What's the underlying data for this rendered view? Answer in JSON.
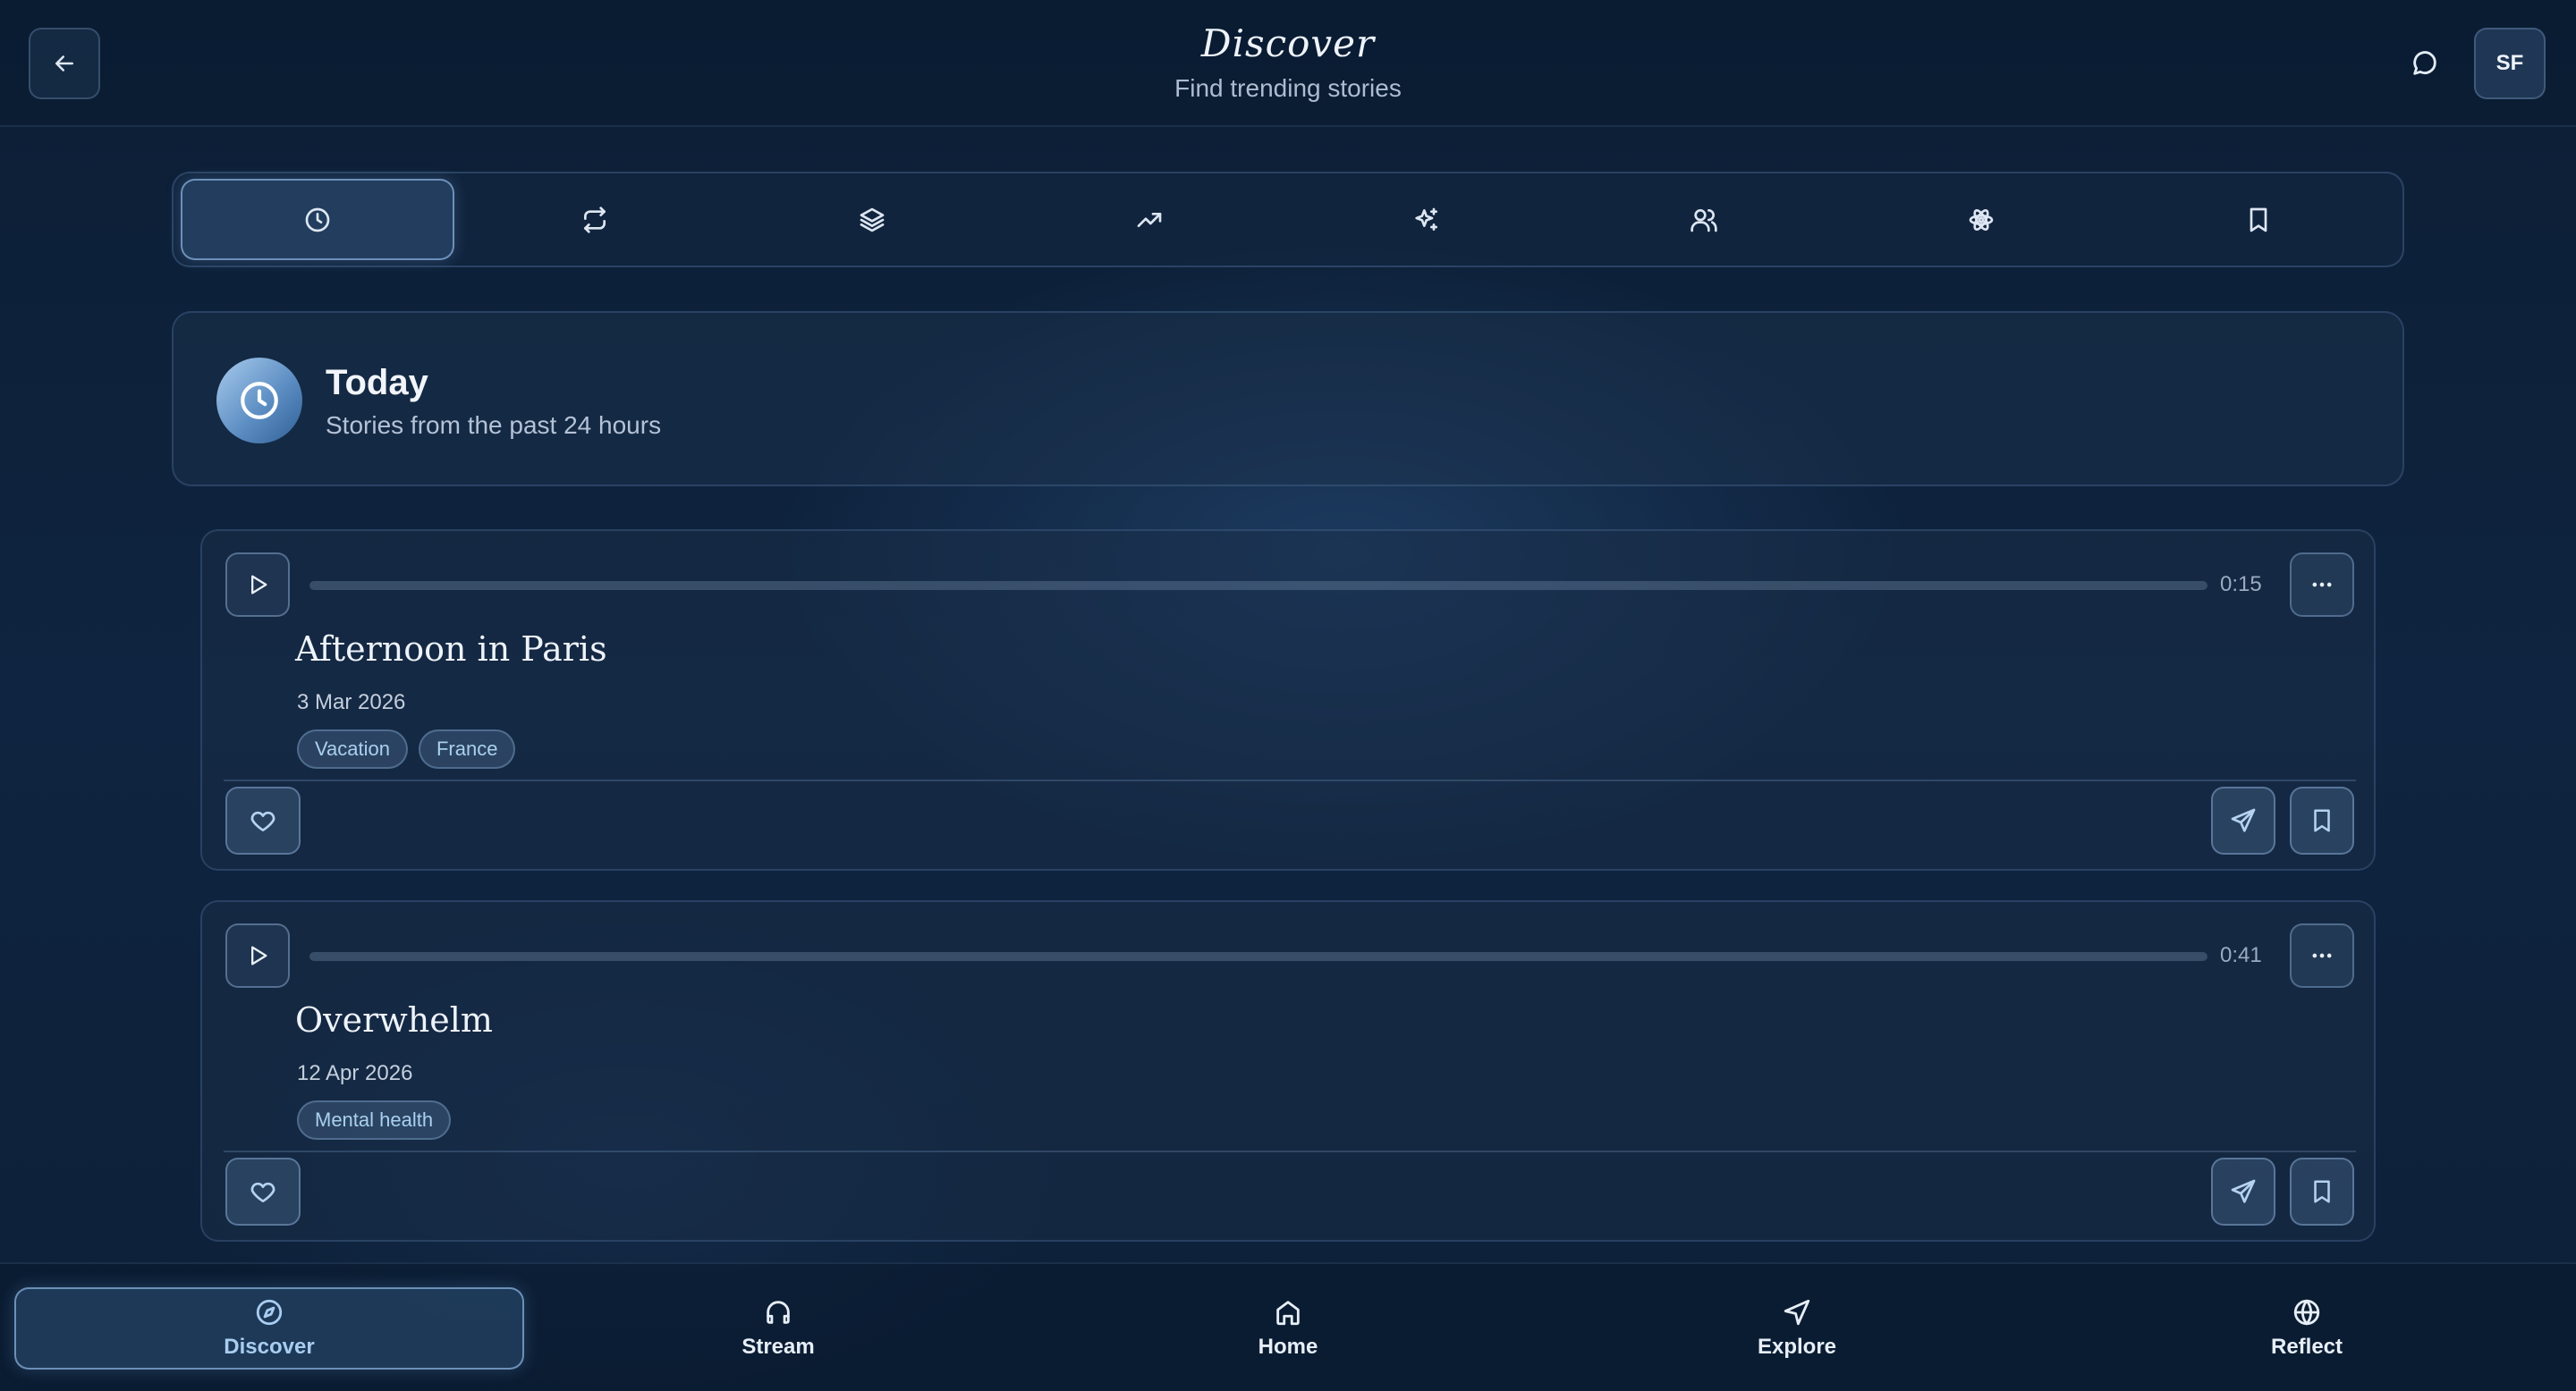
{
  "header": {
    "title": "Discover",
    "subtitle": "Find trending stories",
    "back_icon": "arrow-left-icon",
    "chat_icon": "chat-bubble-icon",
    "avatar_initials": "SF"
  },
  "filters": [
    {
      "icon": "clock-icon",
      "active": true
    },
    {
      "icon": "repeat-icon",
      "active": false
    },
    {
      "icon": "layers-icon",
      "active": false
    },
    {
      "icon": "trending-up-icon",
      "active": false
    },
    {
      "icon": "sparkles-icon",
      "active": false
    },
    {
      "icon": "users-icon",
      "active": false
    },
    {
      "icon": "atom-icon",
      "active": false
    },
    {
      "icon": "bookmark-icon",
      "active": false
    }
  ],
  "section": {
    "title": "Today",
    "subtitle": "Stories from the past 24 hours",
    "icon": "clock-icon"
  },
  "stories": [
    {
      "title": "Afternoon in Paris",
      "date": "3 Mar 2026",
      "duration": "0:15",
      "progress": 0,
      "tags": [
        "Vacation",
        "France"
      ]
    },
    {
      "title": "Overwhelm",
      "date": "12 Apr 2026",
      "duration": "0:41",
      "progress": 0,
      "tags": [
        "Mental health"
      ]
    }
  ],
  "bottom_nav": [
    {
      "label": "Discover",
      "icon": "compass-icon",
      "active": true
    },
    {
      "label": "Stream",
      "icon": "headphones-icon",
      "active": false
    },
    {
      "label": "Home",
      "icon": "home-icon",
      "active": false
    },
    {
      "label": "Explore",
      "icon": "navigation-icon",
      "active": false
    },
    {
      "label": "Reflect",
      "icon": "globe-icon",
      "active": false
    }
  ],
  "colors": {
    "background": "#0f2440",
    "accent": "#8fb6e0",
    "tag_text": "#a9d0f0"
  }
}
